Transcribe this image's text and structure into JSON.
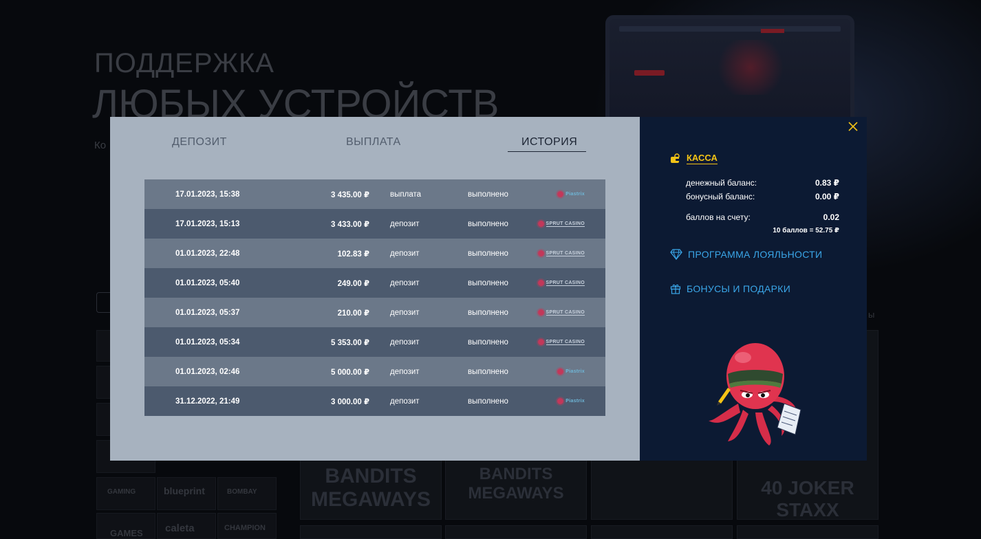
{
  "background": {
    "title_line1": "ПОДДЕРЖКА",
    "title_line2": "ЛЮБЫХ УСТРОЙСТВ",
    "subtitle": "Ко",
    "right_text": "ы",
    "providers": [
      "GAMING",
      "blueprint",
      "BOMBAY",
      "GAMES",
      "caleta",
      "CHAMPION"
    ],
    "games": [
      "BANDITS MEGAWAYS",
      "BANDITS MEGAWAYS",
      "",
      "40 JOKER STAXX"
    ]
  },
  "tabs": [
    {
      "label": "ДЕПОЗИТ",
      "active": false
    },
    {
      "label": "ВЫПЛАТА",
      "active": false
    },
    {
      "label": "ИСТОРИЯ",
      "active": true
    }
  ],
  "history": [
    {
      "date": "17.01.2023, 15:38",
      "amount": "3 435.00 ₽",
      "type": "выплата",
      "status": "выполнено",
      "logo": "flower-small-icon",
      "logo_text": "Piastrix"
    },
    {
      "date": "17.01.2023, 15:13",
      "amount": "3 433.00 ₽",
      "type": "депозит",
      "status": "выполнено",
      "logo": "sprut-casino-logo",
      "logo_text": "SPRUT CASINO"
    },
    {
      "date": "01.01.2023, 22:48",
      "amount": "102.83 ₽",
      "type": "депозит",
      "status": "выполнено",
      "logo": "sprut-casino-logo",
      "logo_text": "SPRUT CASINO"
    },
    {
      "date": "01.01.2023, 05:40",
      "amount": "249.00 ₽",
      "type": "депозит",
      "status": "выполнено",
      "logo": "sprut-casino-logo",
      "logo_text": "SPRUT CASINO"
    },
    {
      "date": "01.01.2023, 05:37",
      "amount": "210.00 ₽",
      "type": "депозит",
      "status": "выполнено",
      "logo": "sprut-casino-logo",
      "logo_text": "SPRUT CASINO"
    },
    {
      "date": "01.01.2023, 05:34",
      "amount": "5 353.00 ₽",
      "type": "депозит",
      "status": "выполнено",
      "logo": "sprut-casino-logo",
      "logo_text": "SPRUT CASINO"
    },
    {
      "date": "01.01.2023, 02:46",
      "amount": "5 000.00 ₽",
      "type": "депозит",
      "status": "выполнено",
      "logo": "flower-small-icon",
      "logo_text": "Piastrix"
    },
    {
      "date": "31.12.2022, 21:49",
      "amount": "3 000.00 ₽",
      "type": "депозит",
      "status": "выполнено",
      "logo": "flower-small-icon",
      "logo_text": "Piastrix"
    }
  ],
  "sidebar": {
    "kassa_label": "КАССА",
    "money_balance_label": "денежный баланс:",
    "money_balance_value": "0.83 ₽",
    "bonus_balance_label": "бонусный баланс:",
    "bonus_balance_value": "0.00 ₽",
    "points_label": "баллов на счету:",
    "points_value": "0.02",
    "points_note": "10 баллов = 52.75 ₽",
    "loyalty_label": "ПРОГРАММА ЛОЯЛЬНОСТИ",
    "bonuses_label": "БОНУСЫ И ПОДАРКИ"
  },
  "colors": {
    "modal_left_bg": "#a7b2bf",
    "modal_right_bg": "#0c1a33",
    "row_light": "#6b7889",
    "row_dark": "#4c5a6e",
    "accent_yellow": "#f4c316",
    "link_blue": "#3aa6e8",
    "mascot_red": "#e0344f"
  }
}
